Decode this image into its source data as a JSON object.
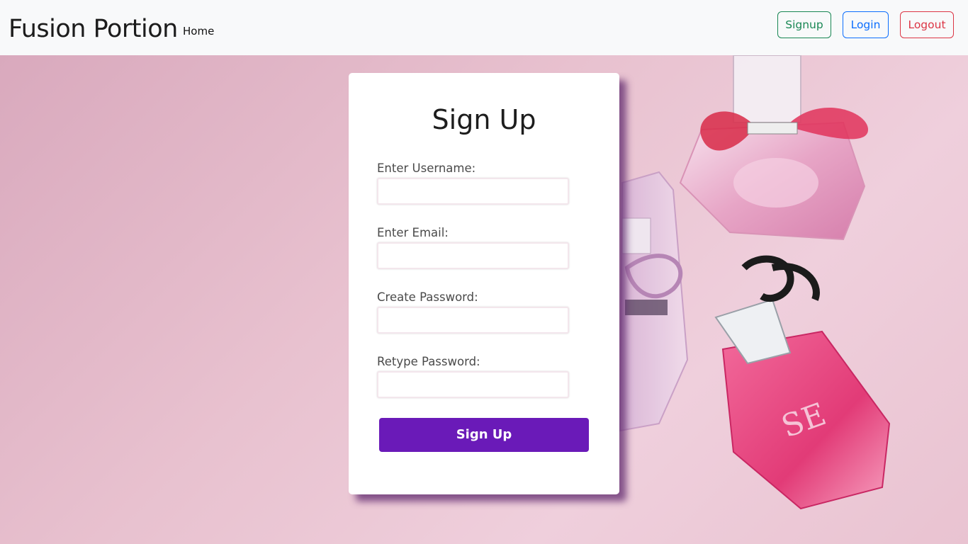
{
  "navbar": {
    "brand": "Fusion Portion",
    "home_link": "Home",
    "buttons": {
      "signup": "Signup",
      "login": "Login",
      "logout": "Logout"
    }
  },
  "colors": {
    "signup_accent": "#198754",
    "login_accent": "#0d6efd",
    "logout_accent": "#dc3545",
    "submit_button": "#6a1ab8",
    "background_tint": "#e8c1cf"
  },
  "form": {
    "title": "Sign Up",
    "fields": [
      {
        "label": "Enter Username:",
        "value": ""
      },
      {
        "label": "Enter Email:",
        "value": ""
      },
      {
        "label": "Create Password:",
        "value": ""
      },
      {
        "label": "Retype Password:",
        "value": ""
      }
    ],
    "submit_label": "Sign Up"
  },
  "background": {
    "image_icon": "perfume-bottles-image"
  }
}
